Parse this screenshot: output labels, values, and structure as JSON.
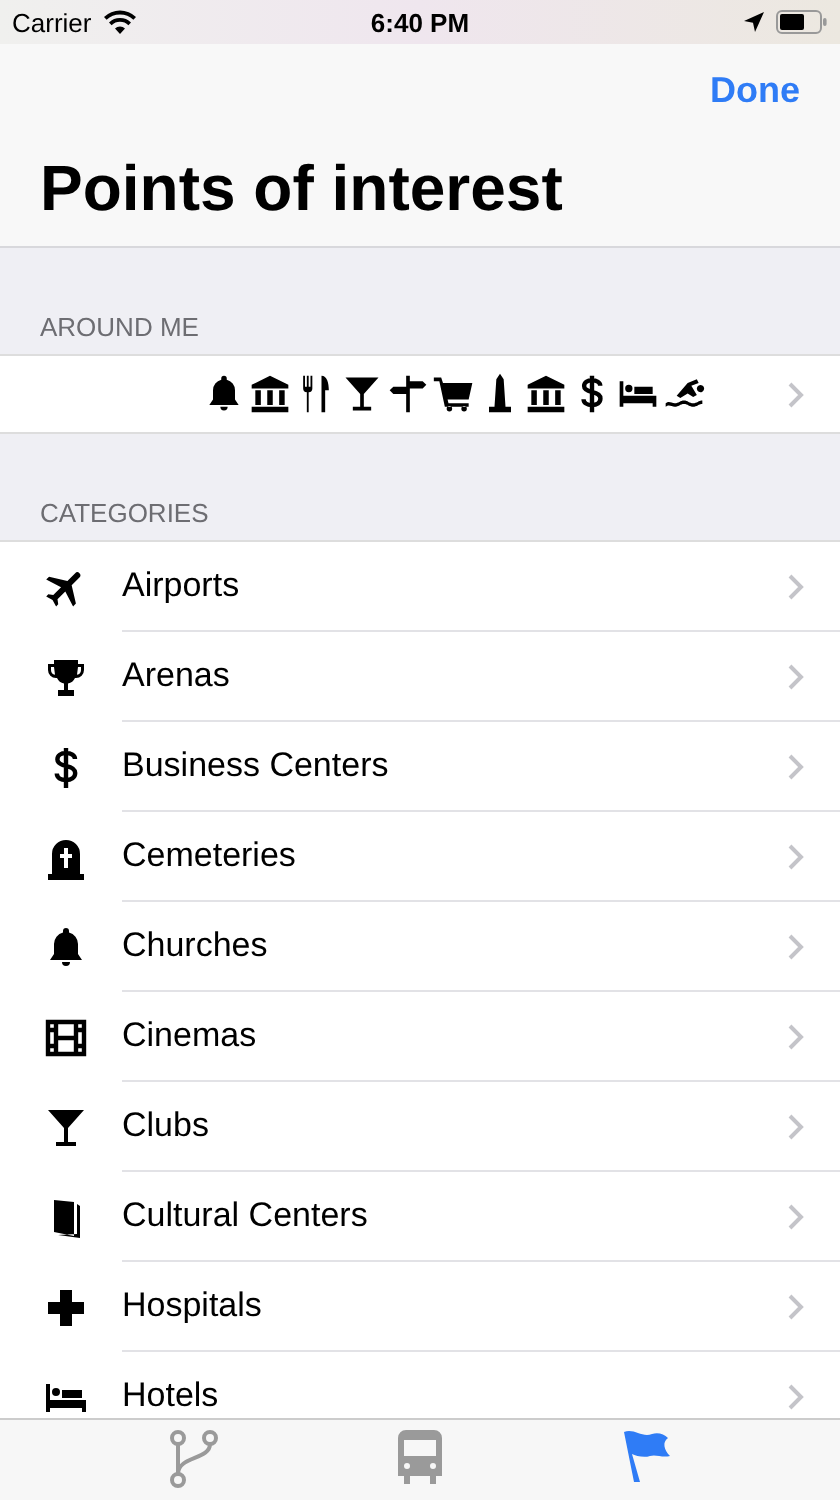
{
  "status_bar": {
    "carrier": "Carrier",
    "time": "6:40 PM"
  },
  "nav_bar": {
    "button": "Done"
  },
  "title": "Points of interest",
  "around_me": {
    "header": "AROUND ME"
  },
  "categories": {
    "header": "CATEGORIES",
    "items": [
      {
        "label": "Airports"
      },
      {
        "label": "Arenas"
      },
      {
        "label": "Business Centers"
      },
      {
        "label": "Cemeteries"
      },
      {
        "label": "Churches"
      },
      {
        "label": "Cinemas"
      },
      {
        "label": "Clubs"
      },
      {
        "label": "Cultural Centers"
      },
      {
        "label": "Hospitals"
      },
      {
        "label": "Hotels"
      }
    ]
  },
  "tab_bar": [
    {
      "selected": false
    },
    {
      "selected": false
    },
    {
      "selected": true
    }
  ]
}
